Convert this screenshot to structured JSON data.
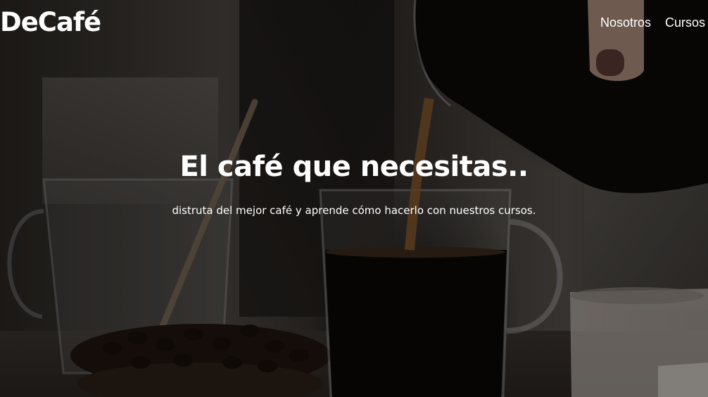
{
  "brand": {
    "logo_text": "DeCafé"
  },
  "nav": {
    "items": [
      {
        "label": "Nosotros"
      },
      {
        "label": "Cursos"
      }
    ]
  },
  "hero": {
    "title": "El café que necesitas..",
    "subtitle": "distruta del mejor café y aprende cómo hacerlo con nuestros cursos.",
    "background_image": "coffee-pour-photo"
  }
}
